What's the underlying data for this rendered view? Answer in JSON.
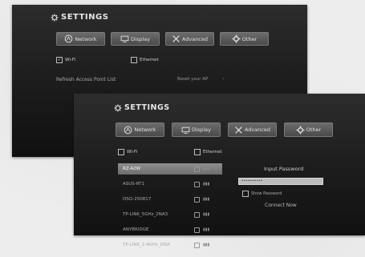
{
  "back_panel": {
    "title": "SETTINGS",
    "tabs": [
      {
        "label": "Network",
        "icon": "network-icon"
      },
      {
        "label": "Display",
        "icon": "display-icon"
      },
      {
        "label": "Advanced",
        "icon": "tools-icon"
      },
      {
        "label": "Other",
        "icon": "gear-icon"
      }
    ],
    "wifi_label": "Wi-Fi",
    "wifi_checked": true,
    "ethernet_label": "Ethernet",
    "ethernet_checked": false,
    "refresh_label": "Refresh Access Point List",
    "reset_label": "Reset your AP",
    "arrow": "›"
  },
  "front_panel": {
    "title": "SETTINGS",
    "tabs": [
      {
        "label": "Network",
        "icon": "network-icon"
      },
      {
        "label": "Display",
        "icon": "display-icon"
      },
      {
        "label": "Advanced",
        "icon": "tools-icon"
      },
      {
        "label": "Other",
        "icon": "gear-icon"
      }
    ],
    "wifi_label": "Wi-Fi",
    "wifi_checked": false,
    "ethernet_label": "Ethernet",
    "ethernet_checked": false,
    "access_points": [
      {
        "name": "RZ-A2W",
        "selected": true
      },
      {
        "name": "ASUS-RT1",
        "selected": false
      },
      {
        "name": "DSO-250817",
        "selected": false
      },
      {
        "name": "TP-LINK_5GHz_2NA3",
        "selected": false
      },
      {
        "name": "ANYBRIDGE",
        "selected": false
      },
      {
        "name": "TP-LINK_2.4GHz_DNA",
        "selected": false
      }
    ],
    "input_password_label": "Input Password",
    "password_value": "••••••••••",
    "show_password_label": "Show Password",
    "connect_label": "Connect Now"
  },
  "colors": {
    "panel_bg": "#1c1c1c",
    "tab_bg": "#5a5a5a",
    "selected_row": "#7d7d7d",
    "page_bg": "#ededed"
  }
}
